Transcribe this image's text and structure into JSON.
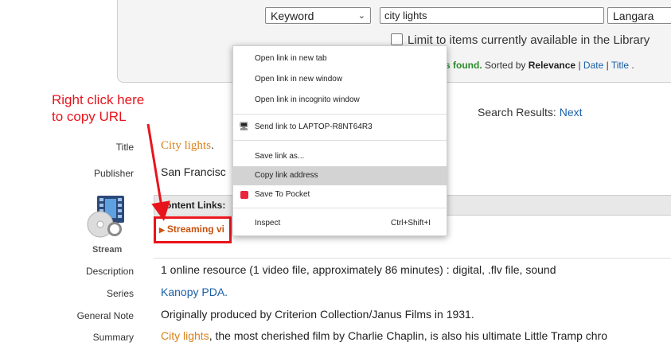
{
  "search": {
    "field_select": "Keyword",
    "keyword_value": "city lights",
    "location_select": "Langara",
    "limit_label": "Limit to items currently available in the Library",
    "found_text": "s found.",
    "sorted_by": "Sorted by",
    "sort_relevance": "Relevance",
    "sort_sep1": " | ",
    "sort_date": "Date",
    "sort_sep2": " | ",
    "sort_title": "Title",
    "sort_end": " ."
  },
  "annotation": {
    "line1": "Right click here",
    "line2": "to copy URL",
    "color": "#e8141c"
  },
  "results_nav": {
    "label": "Search Results:",
    "next": "Next"
  },
  "record": {
    "title_label": "Title",
    "title_value": "City lights",
    "title_punct": ".",
    "publisher_label": "Publisher",
    "publisher_value": "San Francisc",
    "content_links_label": "ontent Links:",
    "streaming_link": "Streaming vi",
    "stream_label": "Stream",
    "description_label": "Description",
    "description_value": "1 online resource (1 video file, approximately 86 minutes) : digital, .flv file, sound",
    "series_label": "Series",
    "series_value": "Kanopy PDA.",
    "general_note_label": "General Note",
    "general_note_value": "Originally produced by Criterion Collection/Janus Films in 1931.",
    "summary_label": "Summary",
    "summary_link": "City lights",
    "summary_rest": ", the most cherished film by Charlie Chaplin, is also his ultimate Little Tramp chro"
  },
  "context_menu": {
    "items": [
      {
        "label": "Open link in new tab"
      },
      {
        "label": "Open link in new window"
      },
      {
        "label": "Open link in incognito window"
      },
      {
        "label": "Send link to LAPTOP-R8NT64R3",
        "icon": "laptop-icon"
      },
      {
        "label": "Save link as..."
      },
      {
        "label": "Copy link address",
        "highlighted": true
      },
      {
        "label": "Save To Pocket",
        "icon": "pocket-icon"
      },
      {
        "label": "Inspect",
        "shortcut": "Ctrl+Shift+I"
      }
    ],
    "highlight_color": "#d3d3d3"
  },
  "colors": {
    "link_blue": "#1a5fa8",
    "title_orange": "#d9821a",
    "found_green": "#2a8a2a"
  }
}
